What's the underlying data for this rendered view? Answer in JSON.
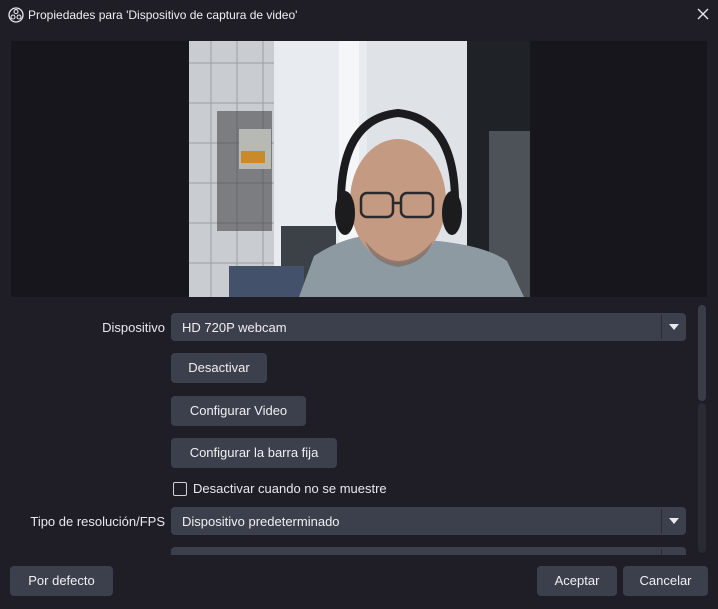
{
  "window": {
    "title": "Propiedades para 'Dispositivo de captura de video'",
    "icon": "obs-icon",
    "close_icon": "close-icon"
  },
  "preview": {
    "content": "webcam-feed"
  },
  "properties": {
    "device_label": "Dispositivo",
    "device_value": "HD 720P webcam",
    "deactivate_button": "Desactivar",
    "configure_video_button": "Configurar Video",
    "configure_crossbar_button": "Configurar la barra fija",
    "deactivate_when_hidden_label": "Desactivar cuando no se muestre",
    "deactivate_when_hidden_checked": false,
    "resolution_type_label": "Tipo de resolución/FPS",
    "resolution_type_value": "Dispositivo predeterminado"
  },
  "footer": {
    "defaults_button": "Por defecto",
    "ok_button": "Aceptar",
    "cancel_button": "Cancelar"
  },
  "colors": {
    "background": "#1f1e26",
    "control": "#3c404d",
    "preview_bg": "#17161c"
  }
}
